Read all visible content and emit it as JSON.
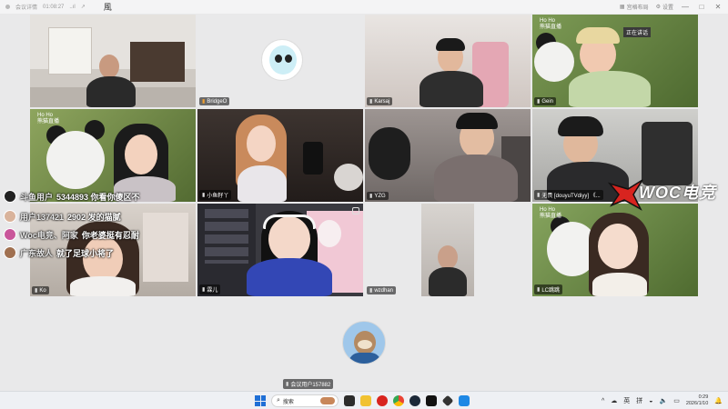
{
  "titlebar": {
    "status_text": "会议详情",
    "elapsed": "01:08:27",
    "signal": "..ıl",
    "app_glyph": "風",
    "layout_label": "宫格布局",
    "settings_label": "设置",
    "minimize": "—",
    "maximize": "□",
    "close": "✕"
  },
  "tiles": [
    {
      "id": "t1",
      "name": "",
      "bg": "#c8c4be"
    },
    {
      "id": "t2",
      "name": "BridgeO",
      "bg": "#e9e9ea"
    },
    {
      "id": "t3",
      "name": "Karsaj",
      "bg": "#cfc7c2"
    },
    {
      "id": "t4",
      "name": "Gein",
      "speaking_label": "正在讲话",
      "brand": "Ho Ho\n熊猫直播",
      "bg": "#6f8a48"
    },
    {
      "id": "t5",
      "name": "",
      "brand": "Ho Ho\n熊猫直播",
      "bg": "#7a8a4a"
    },
    {
      "id": "t6",
      "name": "小鱼籽丫",
      "bg": "#3a3330"
    },
    {
      "id": "t7",
      "name": "YZG",
      "bg": "#8a8482"
    },
    {
      "id": "t8",
      "name": "无畏 [douyuTVdiyy] 《...",
      "bg": "#b8b8b5"
    },
    {
      "id": "t9",
      "name": "Ko",
      "bg": "#c9c2bb"
    },
    {
      "id": "t10",
      "name": "霖儿",
      "bg": "#3a3a40"
    },
    {
      "id": "t11",
      "name": "wzdhan",
      "bg": "#c6c2bf"
    },
    {
      "id": "t12",
      "name": "LC跳跳",
      "brand": "Ho Ho\n熊猫直播",
      "bg": "#6e8c4c"
    },
    {
      "id": "t13",
      "name": "会议用户157882",
      "bg": "#e9e9ea"
    }
  ],
  "danmaku": [
    {
      "user": "斗鱼用户",
      "text": "5344893 你看你傻区不"
    },
    {
      "user": "用户137421",
      "text": "2902 发的猫腻"
    },
    {
      "user": "Woc电竞、阿家",
      "text": "你老婆挺有忍耐"
    },
    {
      "user": "广东故人",
      "text": "就了足球小将了"
    }
  ],
  "logo": {
    "text": "WOC电竞"
  },
  "taskbar": {
    "search_placeholder": "搜索",
    "tray_lang": "英",
    "tray_ime": "拼",
    "time": "0:29",
    "date": "2026/1/10",
    "chevron": "^"
  },
  "colors": {
    "accent": "#1f6fd6",
    "brand_red": "#d8241f"
  }
}
